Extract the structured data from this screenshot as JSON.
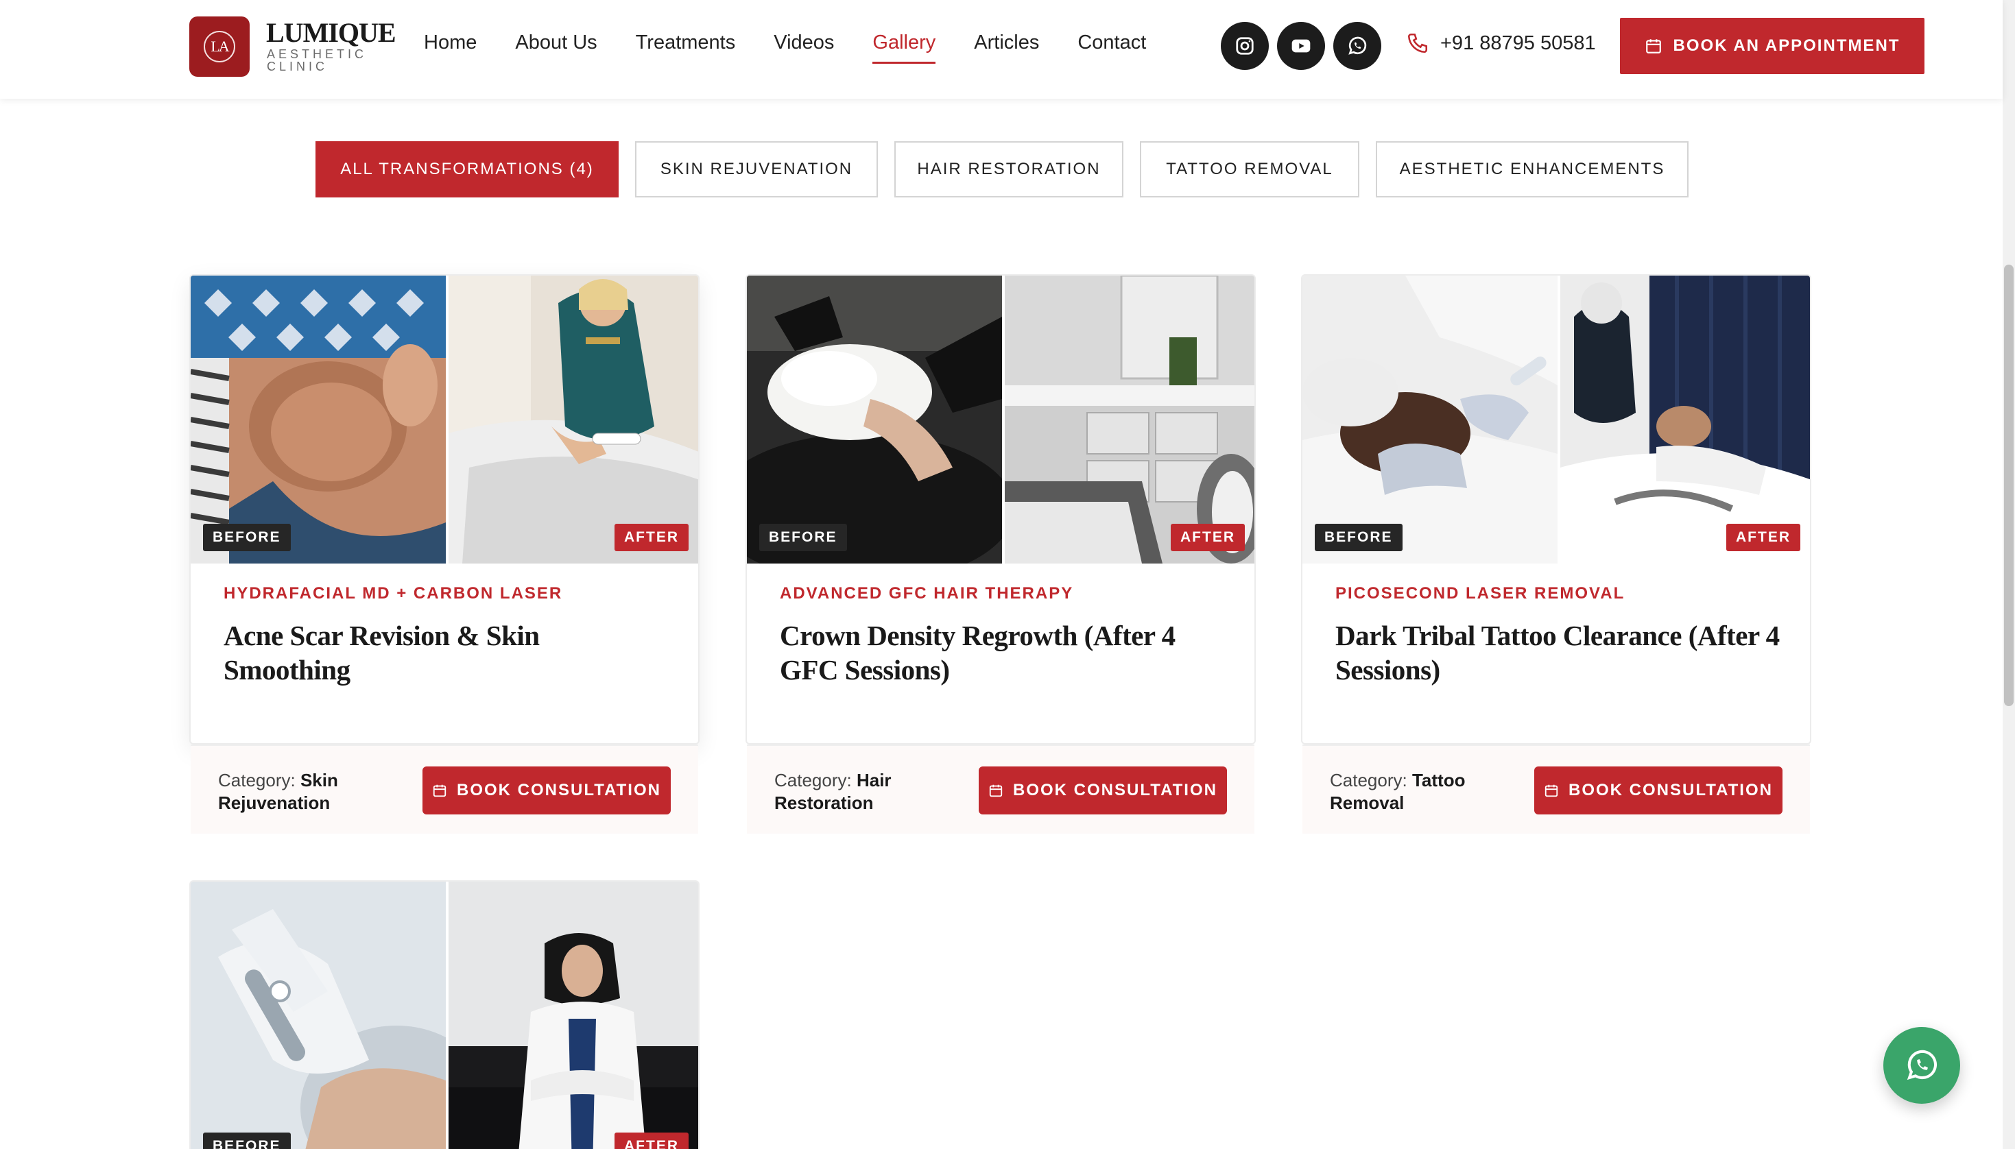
{
  "brand": {
    "name": "LUMIQUE",
    "sub": "AESTHETIC CLINIC",
    "monogram": "LA",
    "accent": "#c0282d"
  },
  "nav": [
    {
      "label": "Home",
      "active": false
    },
    {
      "label": "About Us",
      "active": false
    },
    {
      "label": "Treatments",
      "active": false
    },
    {
      "label": "Videos",
      "active": false
    },
    {
      "label": "Gallery",
      "active": true
    },
    {
      "label": "Articles",
      "active": false
    },
    {
      "label": "Contact",
      "active": false
    }
  ],
  "social": [
    "instagram-icon",
    "youtube-icon",
    "whatsapp-icon"
  ],
  "phone": "+91 88795 50581",
  "book_label": "BOOK AN APPOINTMENT",
  "filters": [
    {
      "label": "ALL TRANSFORMATIONS (4)",
      "active": true
    },
    {
      "label": "SKIN REJUVENATION",
      "active": false
    },
    {
      "label": "HAIR RESTORATION",
      "active": false
    },
    {
      "label": "TATTOO REMOVAL",
      "active": false
    },
    {
      "label": "AESTHETIC ENHANCEMENTS",
      "active": false
    }
  ],
  "badges": {
    "before": "BEFORE",
    "after": "AFTER"
  },
  "cards": [
    {
      "treatment": "HYDRAFACIAL MD + CARBON LASER",
      "title": "Acne Scar Revision & Skin Smoothing",
      "category_label": "Category:",
      "category": "Skin Rejuvenation",
      "button": "BOOK CONSULTATION"
    },
    {
      "treatment": "ADVANCED GFC HAIR THERAPY",
      "title": "Crown Density Regrowth (After 4 GFC Sessions)",
      "category_label": "Category:",
      "category": "Hair Restoration",
      "button": "BOOK CONSULTATION"
    },
    {
      "treatment": "PICOSECOND LASER REMOVAL",
      "title": "Dark Tribal Tattoo Clearance (After 4 Sessions)",
      "category_label": "Category:",
      "category": "Tattoo Removal",
      "button": "BOOK CONSULTATION"
    },
    {
      "treatment": "",
      "title": "",
      "category_label": "",
      "category": "",
      "button": ""
    }
  ],
  "chat_icon": "whatsapp-icon"
}
